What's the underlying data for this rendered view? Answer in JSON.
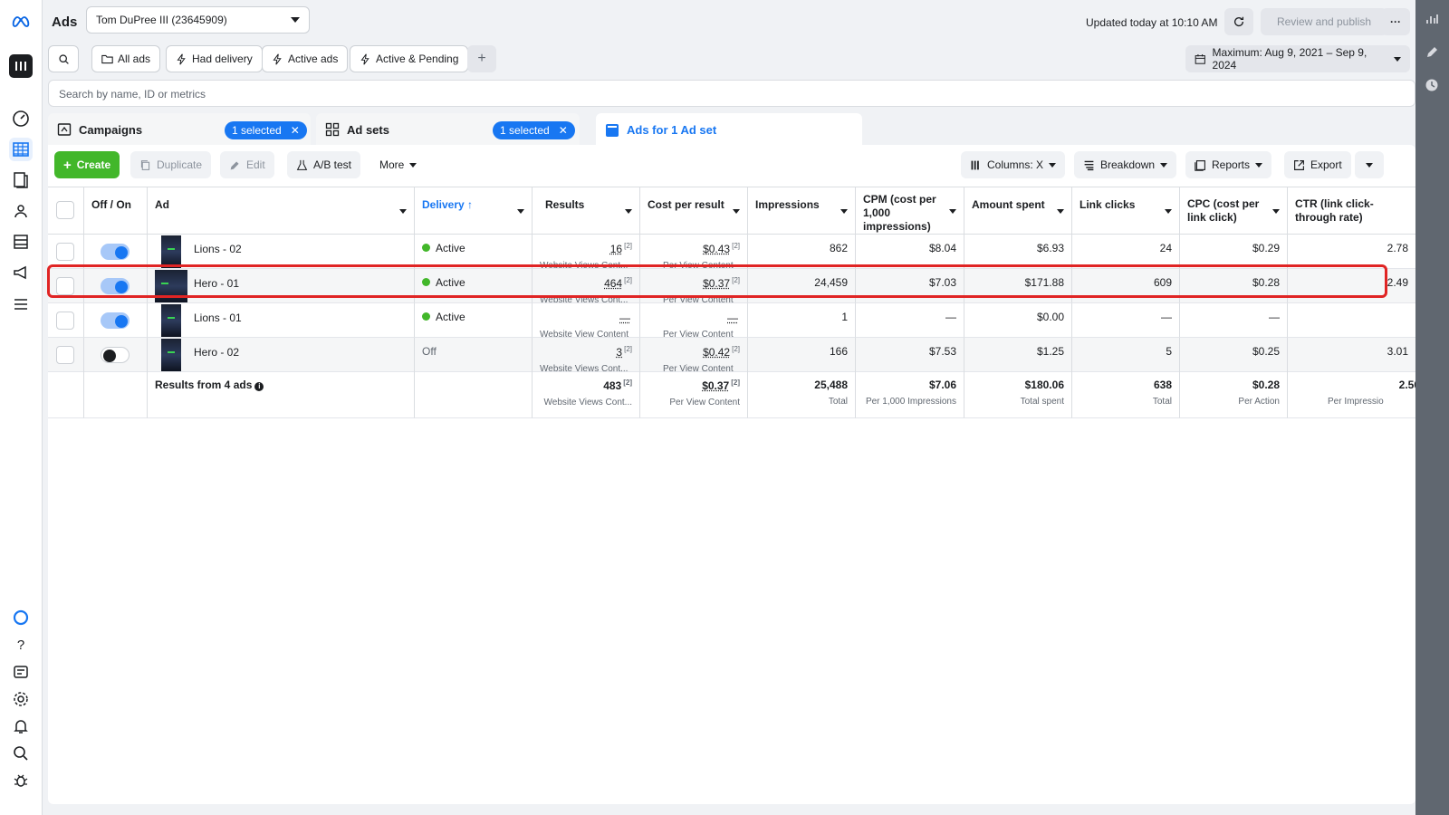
{
  "app": {
    "title": "Ads",
    "account": "Tom DuPree III (23645909)",
    "updated": "Updated today at 10:10 AM",
    "review_label": "Review and publish",
    "more_label": "···"
  },
  "filters": {
    "items": [
      "All ads",
      "Had delivery",
      "Active ads",
      "Active & Pending"
    ],
    "add_label": "+",
    "date_range": "Maximum: Aug 9, 2021 – Sep 9, 2024"
  },
  "search": {
    "placeholder": "Search by name, ID or metrics"
  },
  "tabs": {
    "campaigns": "Campaigns",
    "campaigns_selected": "1 selected",
    "adsets": "Ad sets",
    "adsets_selected": "1 selected",
    "ads": "Ads for 1 Ad set"
  },
  "toolbar": {
    "create": "Create",
    "duplicate": "Duplicate",
    "edit": "Edit",
    "abtest": "A/B test",
    "more": "More",
    "columns": "Columns: X",
    "breakdown": "Breakdown",
    "reports": "Reports",
    "export": "Export"
  },
  "columns": {
    "off_on": "Off / On",
    "ad": "Ad",
    "delivery": "Delivery ↑",
    "results": "Results",
    "cost_per_result": "Cost per result",
    "impressions": "Impressions",
    "cpm": "CPM (cost per 1,000 impressions)",
    "amount_spent": "Amount spent",
    "link_clicks": "Link clicks",
    "cpc": "CPC (cost per link click)",
    "ctr": "CTR (link click-through rate)"
  },
  "rows": [
    {
      "name": "Lions - 02",
      "delivery": "Active",
      "results": "16",
      "results_sup": "[2]",
      "results_sub": "Website Views Cont...",
      "cpr": "$0.43",
      "cpr_sup": "[2]",
      "cpr_sub": "Per View Content",
      "impressions": "862",
      "cpm": "$8.04",
      "spent": "$6.93",
      "clicks": "24",
      "cpc": "$0.29",
      "ctr": "2.78"
    },
    {
      "name": "Hero - 01",
      "delivery": "Active",
      "results": "464",
      "results_sup": "[2]",
      "results_sub": "Website Views Cont...",
      "cpr": "$0.37",
      "cpr_sup": "[2]",
      "cpr_sub": "Per View Content",
      "impressions": "24,459",
      "cpm": "$7.03",
      "spent": "$171.88",
      "clicks": "609",
      "cpc": "$0.28",
      "ctr": "2.49"
    },
    {
      "name": "Lions - 01",
      "delivery": "Active",
      "results": "—",
      "results_sup": "",
      "results_sub": "Website View Content",
      "cpr": "—",
      "cpr_sup": "",
      "cpr_sub": "Per View Content",
      "impressions": "1",
      "cpm": "—",
      "spent": "$0.00",
      "clicks": "—",
      "cpc": "—",
      "ctr": ""
    },
    {
      "name": "Hero - 02",
      "delivery": "Off",
      "results": "3",
      "results_sup": "[2]",
      "results_sub": "Website Views Cont...",
      "cpr": "$0.42",
      "cpr_sup": "[2]",
      "cpr_sub": "Per View Content",
      "impressions": "166",
      "cpm": "$7.53",
      "spent": "$1.25",
      "clicks": "5",
      "cpc": "$0.25",
      "ctr": "3.01"
    }
  ],
  "totals": {
    "label": "Results from 4 ads",
    "results": "483",
    "results_sup": "[2]",
    "results_sub": "Website Views Cont...",
    "cpr": "$0.37",
    "cpr_sup": "[2]",
    "cpr_sub": "Per View Content",
    "impressions": "25,488",
    "impressions_sub": "Total",
    "cpm": "$7.06",
    "cpm_sub": "Per 1,000 Impressions",
    "spent": "$180.06",
    "spent_sub": "Total spent",
    "clicks": "638",
    "clicks_sub": "Total",
    "cpc": "$0.28",
    "cpc_sub": "Per Action",
    "ctr": "2.50",
    "ctr_sub": "Per Impressio"
  },
  "colors": {
    "accent": "#1877f2",
    "create": "#42b72a",
    "highlight": "#e02424"
  },
  "icons": {
    "left_nav": [
      "meta-logo",
      "account-avatar",
      "dashboard-icon",
      "table-icon",
      "pages-icon",
      "audience-icon",
      "catalog-icon",
      "megaphone-icon",
      "menu-icon",
      "loading-ring-icon",
      "help-icon",
      "news-icon",
      "settings-icon",
      "bell-icon",
      "search-icon",
      "bug-icon"
    ],
    "right_rail": [
      "chart-icon",
      "pencil-icon",
      "clock-icon"
    ]
  }
}
